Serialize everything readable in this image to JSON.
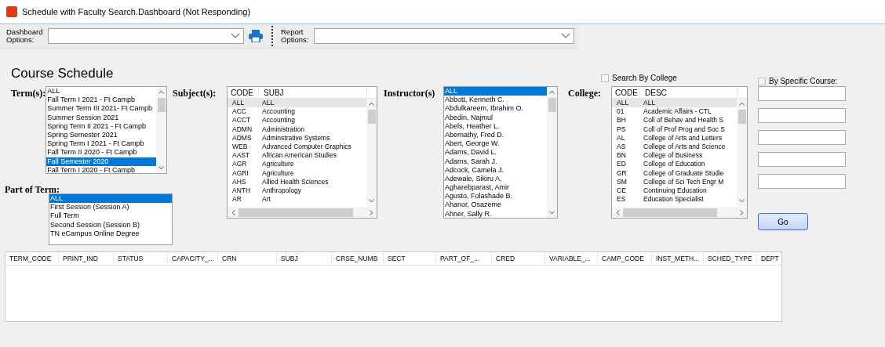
{
  "window": {
    "title": "Schedule with Faculty Search.Dashboard (Not Responding)"
  },
  "toolbar": {
    "dashboard_options": {
      "label": "Dashboard Options:"
    },
    "report_options": {
      "label": "Report Options:"
    }
  },
  "heading": "Course Schedule",
  "search_by_college": {
    "label": "Search By College",
    "checked": false
  },
  "by_specific_course": {
    "label": "By Specific Course:",
    "checked": false
  },
  "terms": {
    "label": "Term(s):",
    "items": [
      {
        "text": "ALL",
        "selected": false
      },
      {
        "text": "Fall Term I 2021 - Ft Campb",
        "selected": false
      },
      {
        "text": "Summer Term III 2021- Ft Campb",
        "selected": false
      },
      {
        "text": "Summer Session 2021",
        "selected": false
      },
      {
        "text": "Spring Term II 2021 - Ft Campb",
        "selected": false
      },
      {
        "text": "Spring Semester 2021",
        "selected": false
      },
      {
        "text": "Spring Term I 2021 - Ft Campb",
        "selected": false
      },
      {
        "text": "Fall Term II 2020 - Ft Campb",
        "selected": false
      },
      {
        "text": "Fall Semester 2020",
        "selected": true
      },
      {
        "text": "Fall Term I 2020 - Ft Campb",
        "selected": false
      }
    ]
  },
  "part_of_term": {
    "label": "Part of Term:",
    "items": [
      {
        "text": "ALL",
        "selected": true
      },
      {
        "text": "First Session (Session A)",
        "selected": false
      },
      {
        "text": "Full Term",
        "selected": false
      },
      {
        "text": "Second Session (Session B)",
        "selected": false
      },
      {
        "text": "TN eCampus Online Degree",
        "selected": false
      }
    ]
  },
  "subjects": {
    "label": "Subject(s):",
    "columns": [
      "CODE",
      "SUBJ"
    ],
    "rows": [
      {
        "code": "ALL",
        "name": "ALL",
        "selected": true
      },
      {
        "code": "ACC",
        "name": "Accounting",
        "selected": false
      },
      {
        "code": "ACCT",
        "name": "Accounting",
        "selected": false
      },
      {
        "code": "ADMN",
        "name": "Administration",
        "selected": false
      },
      {
        "code": "ADMS",
        "name": "Adminstrative Systems",
        "selected": false
      },
      {
        "code": "WEB",
        "name": "Advanced Computer Graphics",
        "selected": false
      },
      {
        "code": "AAST",
        "name": "African American Studies",
        "selected": false
      },
      {
        "code": "AGR",
        "name": "Agriculture",
        "selected": false
      },
      {
        "code": "AGRI",
        "name": "Agriculture",
        "selected": false
      },
      {
        "code": "AHS",
        "name": "Allied Health Sciences",
        "selected": false
      },
      {
        "code": "ANTH",
        "name": "Anthropology",
        "selected": false
      },
      {
        "code": "AR",
        "name": "Art",
        "selected": false
      }
    ]
  },
  "instructors": {
    "label": "Instructor(s)",
    "items": [
      {
        "text": "ALL",
        "selected": true
      },
      {
        "text": "Abbott, Kenneth C.",
        "selected": false
      },
      {
        "text": "Abdulkareem, Ibrahim O.",
        "selected": false
      },
      {
        "text": "Abedin, Najmul",
        "selected": false
      },
      {
        "text": "Abels, Heather L.",
        "selected": false
      },
      {
        "text": "Abernathy, Fred D.",
        "selected": false
      },
      {
        "text": "Abert, George W.",
        "selected": false
      },
      {
        "text": "Adams, David L.",
        "selected": false
      },
      {
        "text": "Adams, Sarah J.",
        "selected": false
      },
      {
        "text": "Adcock, Camela J.",
        "selected": false
      },
      {
        "text": "Adewale, Sikiru A.",
        "selected": false
      },
      {
        "text": "Agharebparast, Amir",
        "selected": false
      },
      {
        "text": "Agusto, Folashade B.",
        "selected": false
      },
      {
        "text": "Ahanor, Osazeme",
        "selected": false
      },
      {
        "text": "Ahner, Sally R.",
        "selected": false
      }
    ]
  },
  "colleges": {
    "label": "College:",
    "columns": [
      "CODE",
      "DESC"
    ],
    "rows": [
      {
        "code": "ALL",
        "name": "ALL",
        "selected": true
      },
      {
        "code": "01",
        "name": "Academic Affairs - CTL",
        "selected": false
      },
      {
        "code": "BH",
        "name": "Coll of Behav and Health S",
        "selected": false
      },
      {
        "code": "PS",
        "name": "Coll of Prof Prog and Soc S",
        "selected": false
      },
      {
        "code": "AL",
        "name": "College of Arts and Letters",
        "selected": false
      },
      {
        "code": "AS",
        "name": "College of Arts and Science",
        "selected": false
      },
      {
        "code": "BN",
        "name": "College of Business",
        "selected": false
      },
      {
        "code": "ED",
        "name": "College of Education",
        "selected": false
      },
      {
        "code": "GR",
        "name": "College of Graduate Studie",
        "selected": false
      },
      {
        "code": "SM",
        "name": "College of Sci Tech Engr M",
        "selected": false
      },
      {
        "code": "CE",
        "name": "Continuing Education",
        "selected": false
      },
      {
        "code": "ES",
        "name": "Education Specialist",
        "selected": false
      }
    ]
  },
  "go_button": "Go",
  "results_table": {
    "columns": [
      "TERM_CODE",
      "PRINT_IND",
      "STATUS",
      "CAPACITY_...",
      "CRN",
      "SUBJ",
      "CRSE_NUMB",
      "SECT",
      "PART_OF_...",
      "CRED",
      "VARIABLE_...",
      "CAMP_CODE",
      "INST_METH...",
      "SCHED_TYPE",
      "DEPT"
    ]
  }
}
